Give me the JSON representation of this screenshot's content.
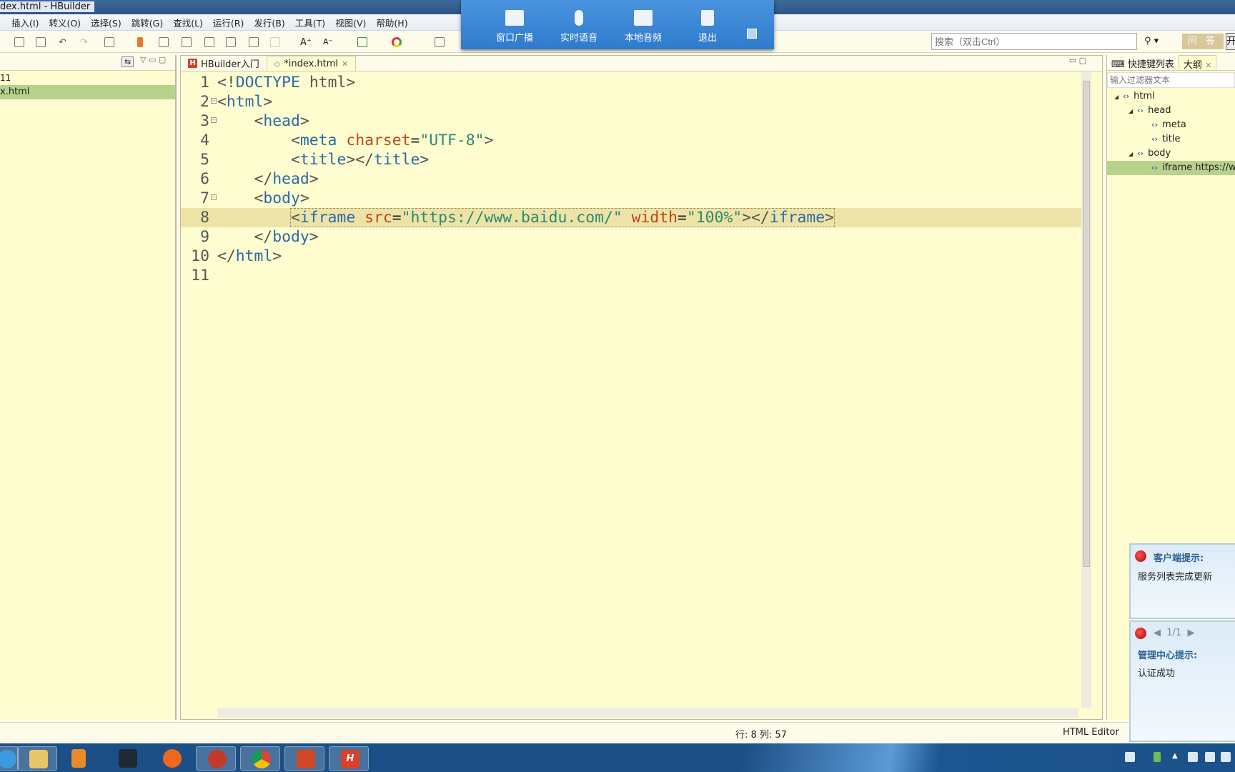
{
  "window": {
    "title": "dex.html  -  HBuilder"
  },
  "menu": [
    "插入(I)",
    "转义(O)",
    "选择(S)",
    "跳转(G)",
    "查找(L)",
    "运行(R)",
    "发行(B)",
    "工具(T)",
    "视图(V)",
    "帮助(H)"
  ],
  "search": {
    "placeholder": "搜索（双击Ctrl）",
    "qa_label": "问 答",
    "open_label": "开"
  },
  "float_bar": {
    "buttons": [
      "窗口广播",
      "实时语音",
      "本地音频",
      "退出"
    ]
  },
  "left_panel": {
    "items": [
      "11",
      "x.html"
    ]
  },
  "editor": {
    "tabs": [
      {
        "label": "HBuilder入门"
      },
      {
        "label": "*index.html"
      }
    ],
    "lines": [
      [
        "1",
        "<!DOCTYPE html>"
      ],
      [
        "2",
        "<html>"
      ],
      [
        "3",
        "<head>"
      ],
      [
        "4",
        "<meta charset=\"UTF-8\">"
      ],
      [
        "5",
        "<title></title>"
      ],
      [
        "6",
        "</head>"
      ],
      [
        "7",
        "<body>"
      ],
      [
        "8",
        "<iframe src=\"https://www.baidu.com/\" width=\"100%\"></iframe>"
      ],
      [
        "9",
        "</body>"
      ],
      [
        "10",
        "</html>"
      ],
      [
        "11",
        ""
      ]
    ],
    "current_line": 8
  },
  "outline": {
    "tabs": [
      "快捷键列表",
      "大纲"
    ],
    "filter_placeholder": "输入过滤器文本",
    "nodes": [
      "html",
      "head",
      "meta",
      "title",
      "body",
      "iframe https://ww"
    ]
  },
  "status": {
    "position": "行: 8 列: 57",
    "editor_type": "HTML Editor"
  },
  "notifications": [
    {
      "title": "客户端提示:",
      "body": "服务列表完成更新"
    },
    {
      "pager": "1/1",
      "title": "管理中心提示:",
      "body": "认证成功"
    }
  ],
  "taskbar": {
    "apps": [
      "ie",
      "explorer",
      "media-player",
      "nox",
      "firefox",
      "dictionary",
      "chrome",
      "powerpoint",
      "hbuilder"
    ]
  },
  "colors": {
    "editor_bg": "#fefdd0",
    "tag": "#2a6aa8",
    "attr": "#c0441a",
    "string": "#2c8a6f",
    "current_line": "#ede3a6",
    "selection": "#b8d28c"
  }
}
